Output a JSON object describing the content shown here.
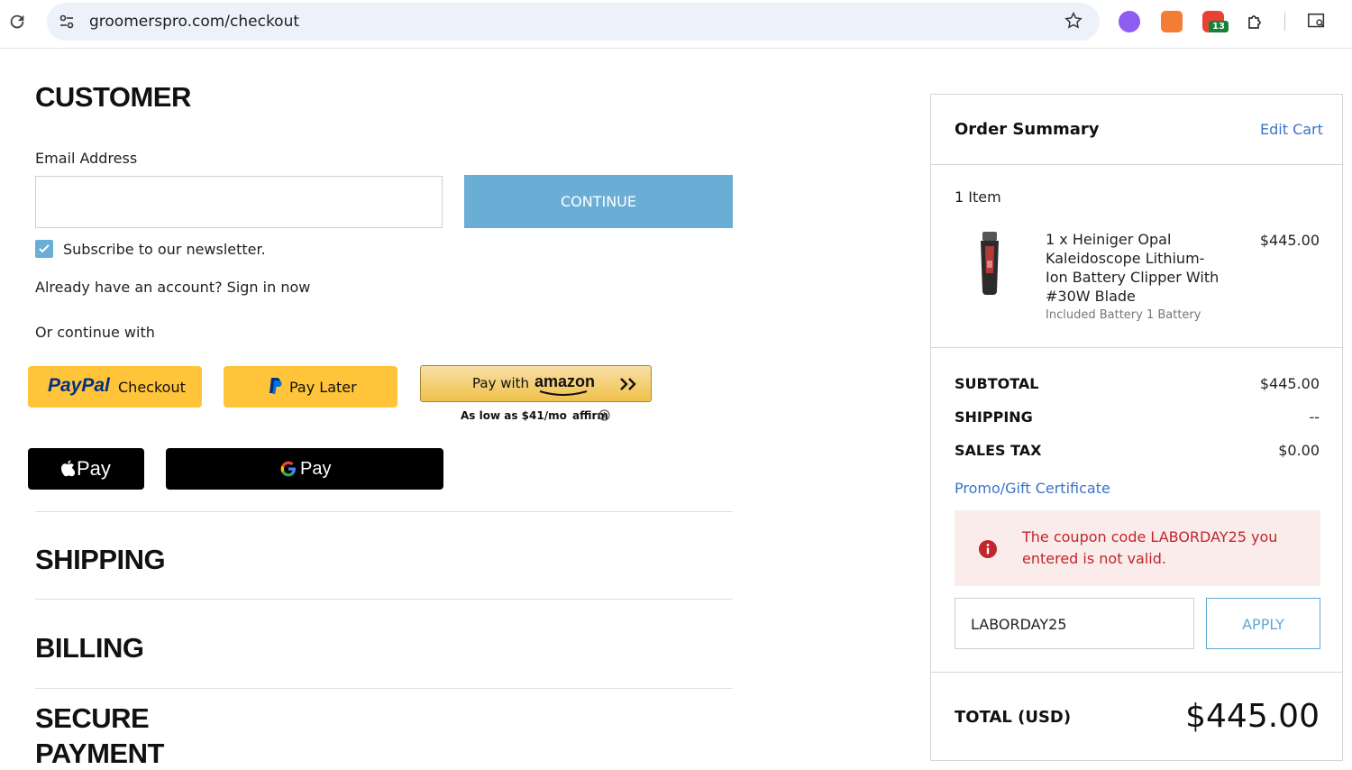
{
  "browser": {
    "url": "groomerspro.com/checkout",
    "ext_badge": "13"
  },
  "customer": {
    "heading": "CUSTOMER",
    "email_label": "Email Address",
    "email_value": "",
    "continue_label": "CONTINUE",
    "newsletter_label": "Subscribe to our newsletter.",
    "newsletter_checked": true,
    "signin_text": "Already have an account? Sign in now",
    "or_continue": "Or continue with"
  },
  "payments": {
    "paypal_brand": "PayPal",
    "paypal_label": "Checkout",
    "paylater_label": "Pay Later",
    "amazon_prefix": "Pay with",
    "amazon_brand": "amazon",
    "affirm_text": "As low as $41/mo",
    "affirm_brand": "affirm",
    "applepay_label": "Pay",
    "gpay_label": "Pay"
  },
  "sections": {
    "shipping": "SHIPPING",
    "billing": "BILLING",
    "secure_payment_1": "SECURE",
    "secure_payment_2": "PAYMENT"
  },
  "summary": {
    "title": "Order Summary",
    "edit_cart": "Edit Cart",
    "item_count": "1 Item",
    "item": {
      "name_line1": "1 x Heiniger Opal",
      "name_line2": "Kaleidoscope Lithium-",
      "name_line3": "Ion Battery Clipper With",
      "name_line4": "#30W Blade",
      "option": "Included Battery 1 Battery",
      "price": "$445.00"
    },
    "subtotal_label": "SUBTOTAL",
    "subtotal_value": "$445.00",
    "shipping_label": "SHIPPING",
    "shipping_value": "--",
    "tax_label": "SALES TAX",
    "tax_value": "$0.00",
    "promo_link": "Promo/Gift Certificate",
    "error_line1": "The coupon code LABORDAY25 you",
    "error_line2": "entered is not valid.",
    "coupon_value": "LABORDAY25",
    "apply_label": "APPLY",
    "total_label": "TOTAL (USD)",
    "total_value": "$445.00"
  },
  "colors": {
    "accent": "#6aaed6",
    "link": "#3b73c6",
    "error": "#c0262d",
    "paypal_yellow": "#ffc439"
  }
}
